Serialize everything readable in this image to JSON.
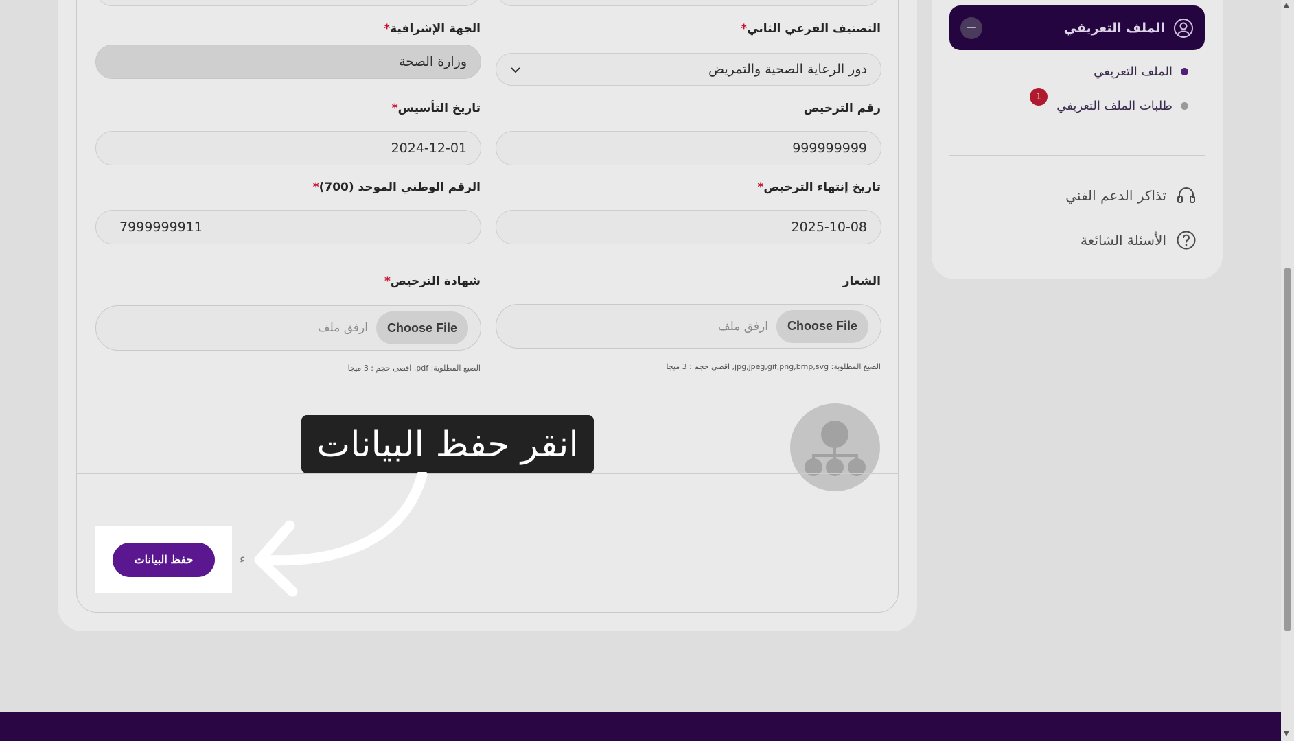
{
  "form": {
    "fields": [
      {
        "id": "supervising_entity",
        "label": "الجهة الإشرافية",
        "required": true,
        "value": "وزارة الصحة",
        "readonly": true
      },
      {
        "id": "second_subcategory",
        "label": "التصنيف الفرعي الثاني",
        "required": true,
        "value": "دور الرعاية الصحية والتمريض",
        "type": "select"
      },
      {
        "id": "founding_date",
        "label": "تاريخ التأسيس",
        "required": true,
        "value": "2024-12-01"
      },
      {
        "id": "license_number",
        "label": "رقم الترخيص",
        "required": false,
        "value": "999999999"
      },
      {
        "id": "unified_national_number",
        "label": "الرقم الوطني الموحد (700)",
        "required": true,
        "value": "7999999911"
      },
      {
        "id": "license_expiry",
        "label": "تاريخ إنتهاء الترخيص",
        "required": true,
        "value": "2025-10-08"
      }
    ],
    "files": [
      {
        "id": "license_certificate",
        "label": "شهادة الترخيص",
        "required": true,
        "button": "Choose File",
        "placeholder": "ارفق ملف",
        "hint": "الصيغ المطلوبة: pdf, اقصى حجم : 3 ميجا"
      },
      {
        "id": "logo",
        "label": "الشعار",
        "required": false,
        "button": "Choose File",
        "placeholder": "ارفق ملف",
        "hint": "الصيغ المطلوبة: jpg,jpeg,gif,png,bmp,svg, اقصى حجم : 3 ميجا"
      }
    ],
    "save_label": "حفظ البيانات",
    "cancel_fragment": "ء"
  },
  "sidebar": {
    "active_section": "الملف التعريفي",
    "collapse_symbol": "−",
    "sub_items": [
      {
        "label": "الملف التعريفي",
        "active": true
      },
      {
        "label": "طلبات الملف التعريفي",
        "active": false,
        "badge": "1"
      }
    ],
    "nav_items": [
      {
        "label": "تذاكر الدعم الفني",
        "icon": "headset-icon"
      },
      {
        "label": "الأسئلة الشائعة",
        "icon": "question-circle-icon"
      }
    ]
  },
  "tooltip": {
    "text": "انقر حفظ البيانات"
  },
  "colors": {
    "primary": "#5b1790",
    "sidebar_active": "#240540",
    "footer": "#2a0645",
    "required": "#c8102e",
    "badge": "#b01a2e"
  }
}
